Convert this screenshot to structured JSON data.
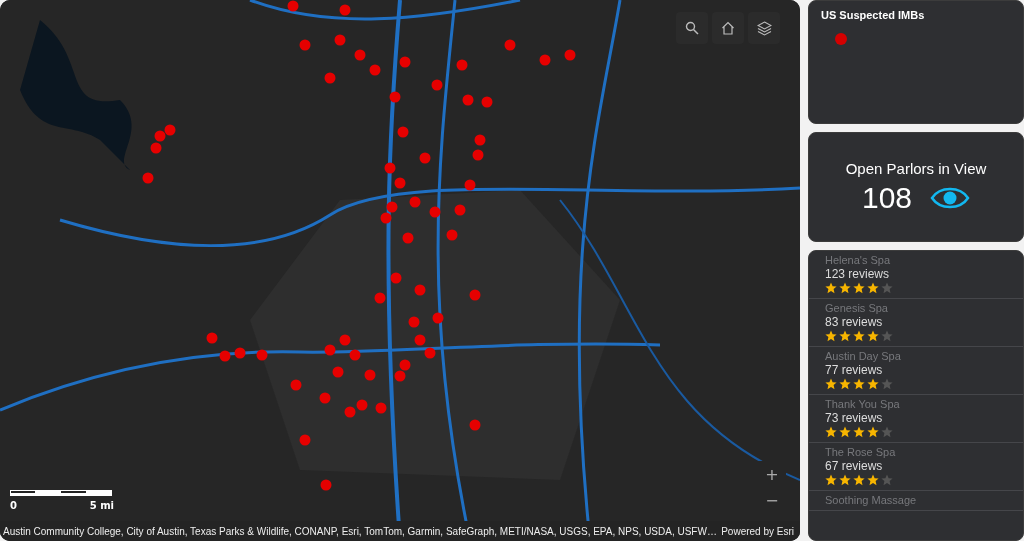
{
  "map": {
    "tools": [
      {
        "kind": "search"
      },
      {
        "kind": "home"
      },
      {
        "kind": "layers"
      }
    ],
    "zoom": [
      "+",
      "−"
    ],
    "scale": {
      "start": "0",
      "end": "5 mi"
    },
    "attribution": "Austin Community College, City of Austin, Texas Parks & Wildlife, CONANP, Esri, TomTom, Garmin, SafeGraph, METI/NASA, USGS, EPA, NPS, USDA, USFW…",
    "powered_by": "Powered by Esri"
  },
  "legend": {
    "title": "US Suspected IMBs",
    "items": [
      {
        "color": "#d40000"
      }
    ]
  },
  "indicator": {
    "title": "Open Parlors in View",
    "value": "108"
  },
  "list": [
    {
      "name": "Helena's Spa",
      "reviews": "123 reviews",
      "stars": 4
    },
    {
      "name": "Genesis Spa",
      "reviews": "83 reviews",
      "stars": 4
    },
    {
      "name": "Austin Day Spa",
      "reviews": "77 reviews",
      "stars": 4
    },
    {
      "name": "Thank You Spa",
      "reviews": "73 reviews",
      "stars": 4
    },
    {
      "name": "The Rose Spa",
      "reviews": "67 reviews",
      "stars": 4
    },
    {
      "name": "Soothing Massage"
    }
  ]
}
